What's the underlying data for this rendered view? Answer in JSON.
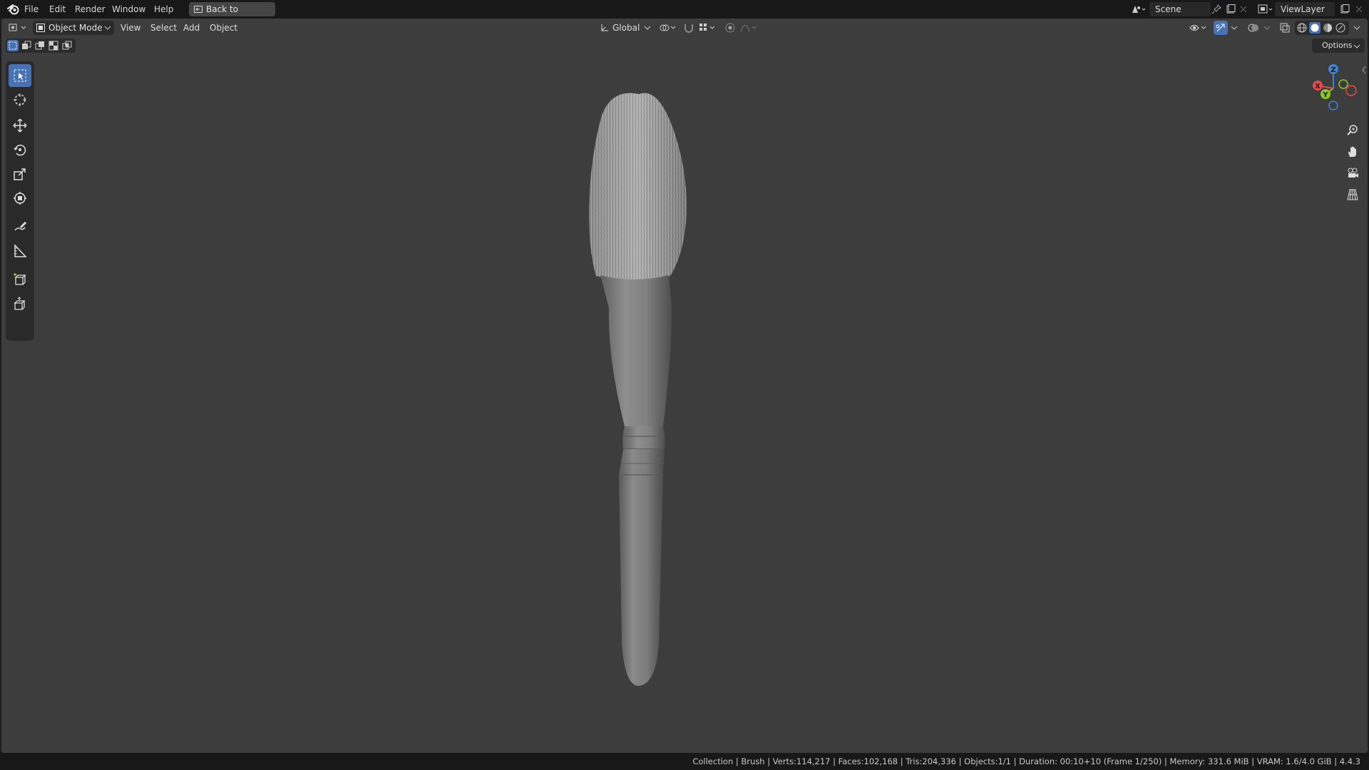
{
  "menubar": {
    "items": [
      "File",
      "Edit",
      "Render",
      "Window",
      "Help"
    ],
    "back_button": "Back to Previous",
    "scene": "Scene",
    "view_layer": "ViewLayer"
  },
  "viewport_header": {
    "mode": "Object Mode",
    "menus": [
      "View",
      "Select",
      "Add",
      "Object"
    ],
    "transform_orientation": "Global",
    "options": "Options"
  },
  "toolbar": {
    "tools": [
      "select-box",
      "cursor",
      "move",
      "rotate",
      "scale",
      "transform",
      "annotate",
      "measure",
      "add-cube",
      "extrude"
    ],
    "active": "select-box"
  },
  "gizmo": {
    "x": "X",
    "y": "Y",
    "z": "Z"
  },
  "status": {
    "text": "Collection | Brush | Verts:114,217 | Faces:102,168 | Tris:204,336 | Objects:1/1 | Duration: 00:10+10 (Frame 1/250) | Memory: 331.6 MiB | VRAM: 1.6/4.0 GiB | 4.4.3"
  },
  "colors": {
    "accent": "#4772b3",
    "viewport_bg": "#3d3d3d",
    "axis_x": "#e74a4a",
    "axis_y": "#8ac52a",
    "axis_z": "#3d83d6"
  }
}
